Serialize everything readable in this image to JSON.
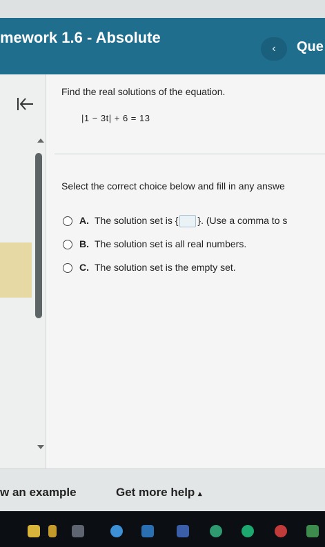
{
  "header": {
    "title": "mework 1.6 - Absolute",
    "nav_back_glyph": "‹",
    "right_text": "Que"
  },
  "question": {
    "prompt": "Find the real solutions of the equation.",
    "equation": "|1 − 3t| + 6 = 13",
    "instruction": "Select the correct choice below and fill in any answe"
  },
  "choices": [
    {
      "letter": "A.",
      "text_before": "The solution set is",
      "brace_open": "{",
      "brace_close": "}",
      "text_after": ". (Use a comma to s"
    },
    {
      "letter": "B.",
      "text": "The solution set is all real numbers."
    },
    {
      "letter": "C.",
      "text": "The solution set is the empty set."
    }
  ],
  "footer": {
    "view_example": "w an example",
    "get_more_help": "Get more help",
    "get_more_help_caret": "▴"
  },
  "colors": {
    "header_bg": "#1f6e8e",
    "content_bg": "#f4f5f4",
    "taskbar_bg": "#0b0e12"
  }
}
